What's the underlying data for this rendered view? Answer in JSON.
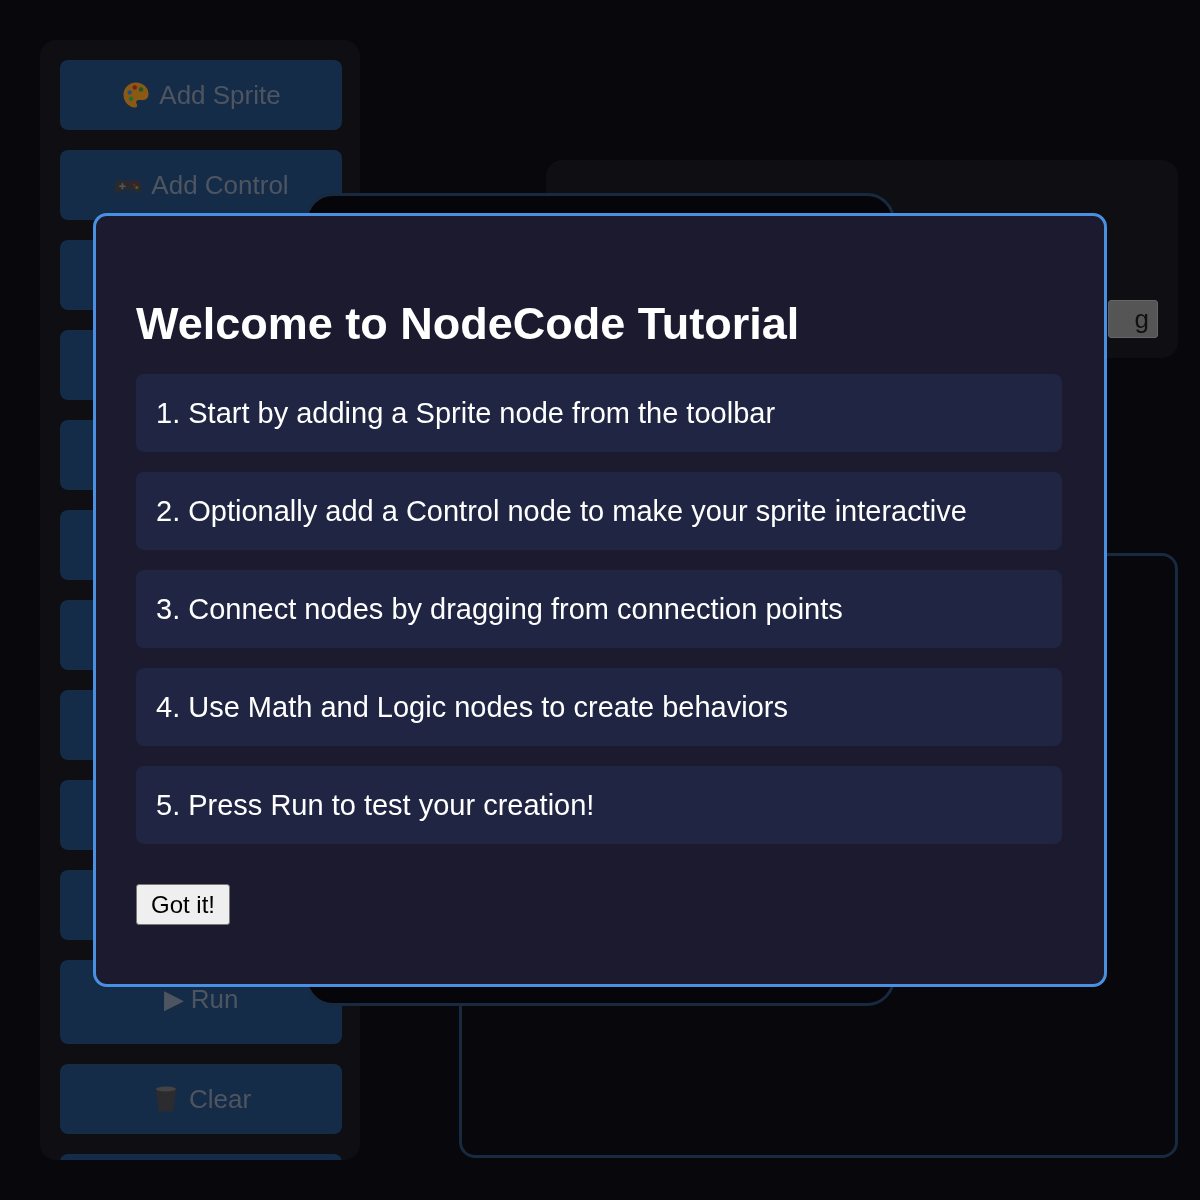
{
  "toolbar": [
    {
      "kind": "sprite",
      "label": "Add Sprite"
    },
    {
      "kind": "control",
      "label": "Add Control"
    },
    {
      "kind": "covered"
    },
    {
      "kind": "covered"
    },
    {
      "kind": "covered"
    },
    {
      "kind": "covered"
    },
    {
      "kind": "covered"
    },
    {
      "kind": "covered"
    },
    {
      "kind": "covered"
    },
    {
      "kind": "covered"
    },
    {
      "kind": "run",
      "label": "▶ Run"
    },
    {
      "kind": "clear",
      "label": "Clear"
    },
    {
      "kind": "cut"
    }
  ],
  "panel": {
    "button": "g"
  },
  "dialog": {
    "title": "Welcome to NodeCode Tutorial",
    "steps": [
      "1. Start by adding a Sprite node from the toolbar",
      "2. Optionally add a Control node to make your sprite interactive",
      "3. Connect nodes by dragging from connection points",
      "4. Use Math and Logic nodes to create behaviors",
      "5. Press Run to test your creation!"
    ],
    "button": "Got it!"
  }
}
